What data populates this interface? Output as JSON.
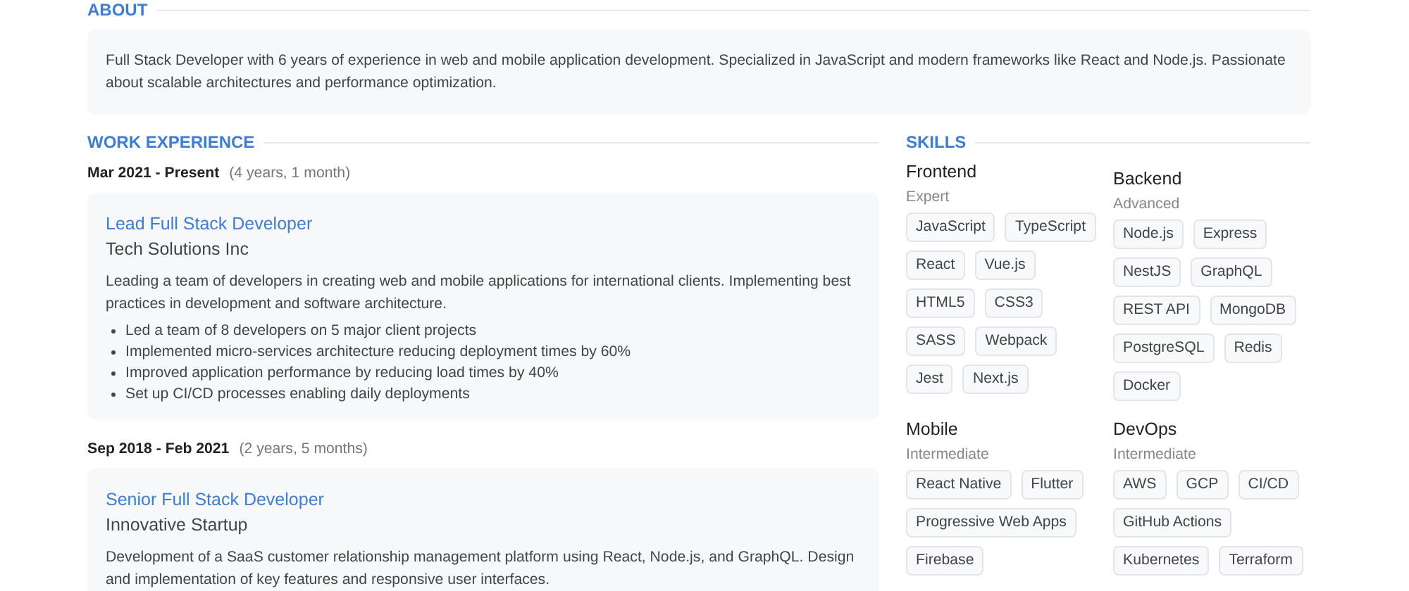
{
  "about": {
    "title": "ABOUT",
    "text": "Full Stack Developer with 6 years of experience in web and mobile application development. Specialized in JavaScript and modern frameworks like React and Node.js. Passionate about scalable architectures and performance optimization."
  },
  "work_experience": {
    "title": "WORK EXPERIENCE",
    "jobs": [
      {
        "period": "Mar 2021 - Present",
        "duration": "(4 years, 1 month)",
        "role": "Lead Full Stack Developer",
        "company": "Tech Solutions Inc",
        "description": "Leading a team of developers in creating web and mobile applications for international clients. Implementing best practices in development and software architecture.",
        "achievements": [
          "Led a team of 8 developers on 5 major client projects",
          "Implemented micro-services architecture reducing deployment times by 60%",
          "Improved application performance by reducing load times by 40%",
          "Set up CI/CD processes enabling daily deployments"
        ]
      },
      {
        "period": "Sep 2018 - Feb 2021",
        "duration": "(2 years, 5 months)",
        "role": "Senior Full Stack Developer",
        "company": "Innovative Startup",
        "description": "Development of a SaaS customer relationship management platform using React, Node.js, and GraphQL. Design and implementation of key features and responsive user interfaces."
      }
    ]
  },
  "skills": {
    "title": "SKILLS",
    "groups": [
      {
        "name": "Frontend",
        "level": "Expert",
        "items": [
          "JavaScript",
          "TypeScript",
          "React",
          "Vue.js",
          "HTML5",
          "CSS3",
          "SASS",
          "Webpack",
          "Jest",
          "Next.js"
        ]
      },
      {
        "name": "Backend",
        "level": "Advanced",
        "items": [
          "Node.js",
          "Express",
          "NestJS",
          "GraphQL",
          "REST API",
          "MongoDB",
          "PostgreSQL",
          "Redis",
          "Docker"
        ]
      },
      {
        "name": "Mobile",
        "level": "Intermediate",
        "items": [
          "React Native",
          "Flutter",
          "Progressive Web Apps",
          "Firebase"
        ]
      },
      {
        "name": "DevOps",
        "level": "Intermediate",
        "items": [
          "AWS",
          "GCP",
          "CI/CD",
          "GitHub Actions",
          "Kubernetes",
          "Terraform"
        ]
      }
    ]
  }
}
